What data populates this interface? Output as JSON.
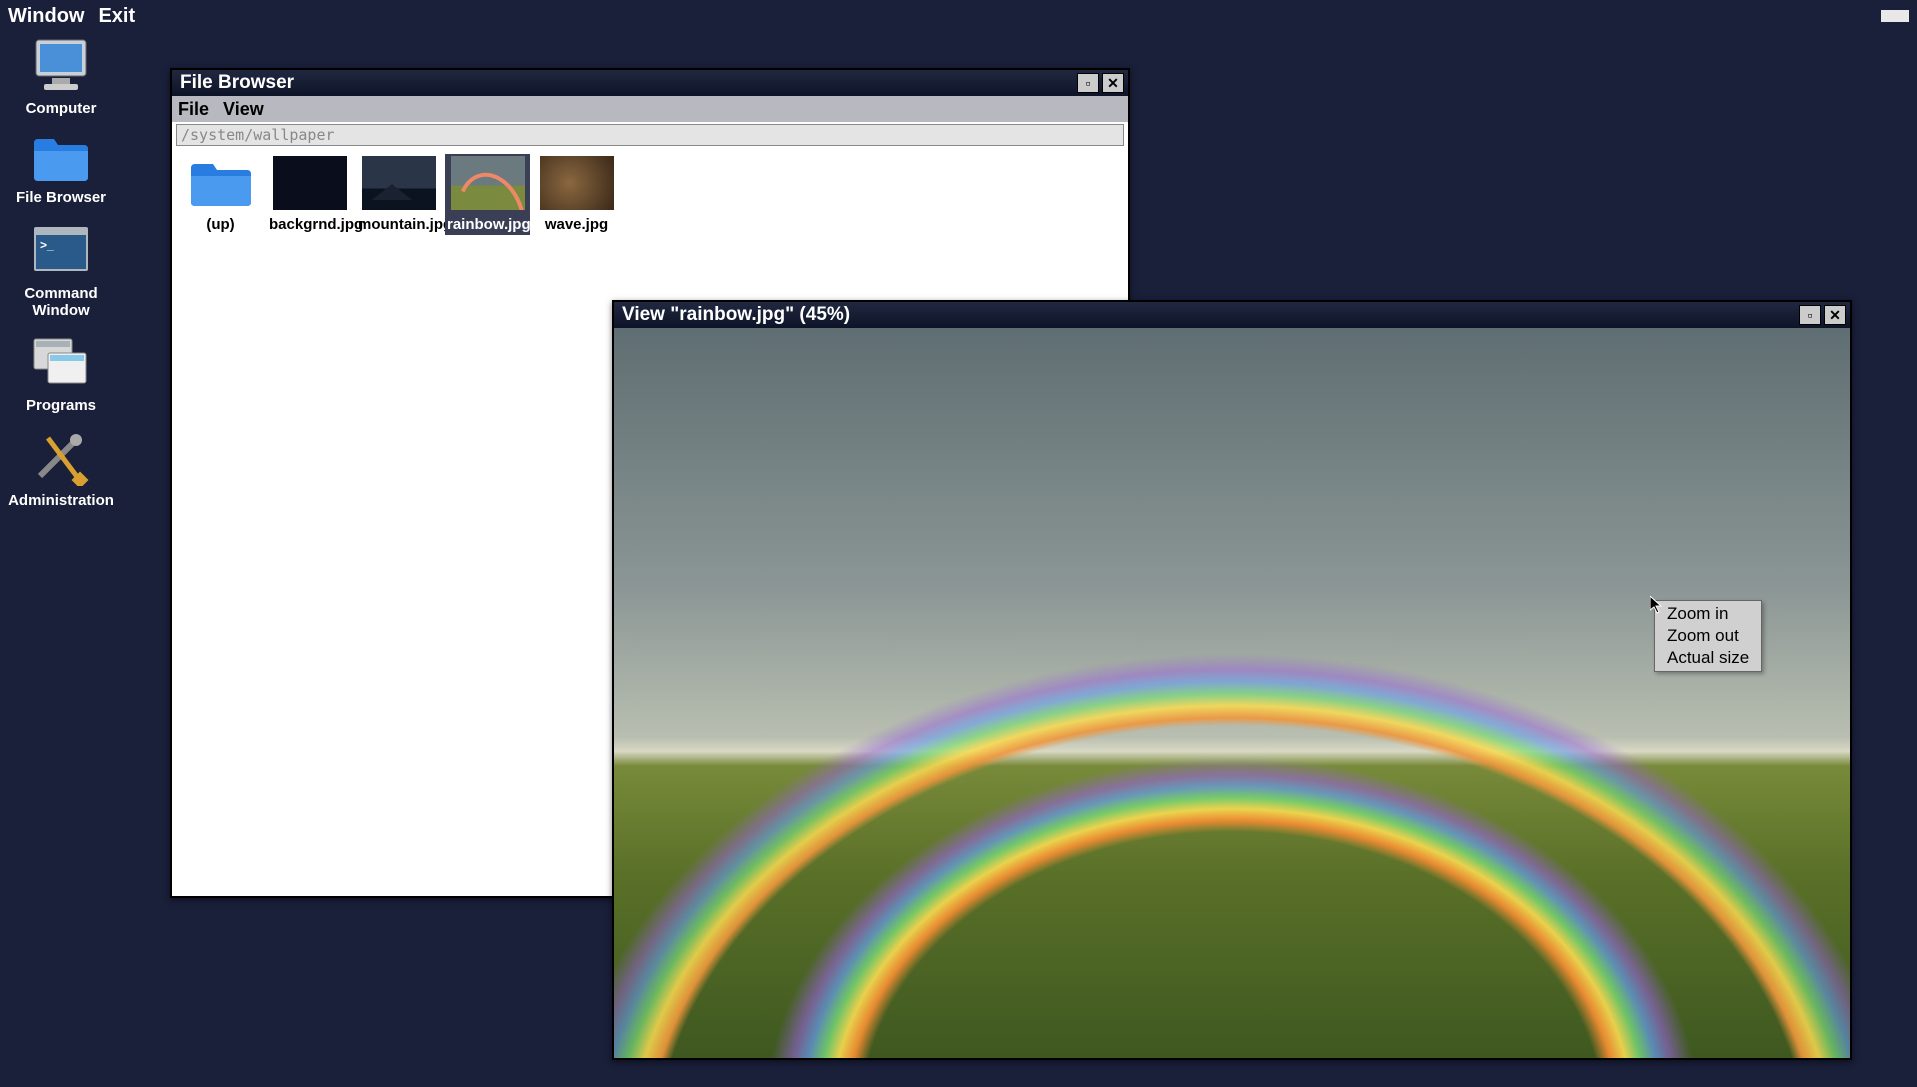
{
  "menubar": {
    "window": "Window",
    "exit": "Exit"
  },
  "desktop": {
    "computer": "Computer",
    "filebrowser": "File Browser",
    "commandwindow": "Command Window",
    "programs": "Programs",
    "administration": "Administration"
  },
  "filebrowser": {
    "title": "File Browser",
    "menu": {
      "file": "File",
      "view": "View"
    },
    "path": "/system/wallpaper",
    "items": {
      "up": "(up)",
      "backgrnd": "backgrnd.jpg",
      "mountain": "mountain.jpg",
      "rainbow": "rainbow.jpg",
      "wave": "wave.jpg"
    }
  },
  "viewer": {
    "title": "View \"rainbow.jpg\" (45%)"
  },
  "contextmenu": {
    "zoomin": "Zoom in",
    "zoomout": "Zoom out",
    "actualsize": "Actual size"
  },
  "winbuttons": {
    "minimize_glyph": "▫",
    "close_glyph": "✕"
  }
}
